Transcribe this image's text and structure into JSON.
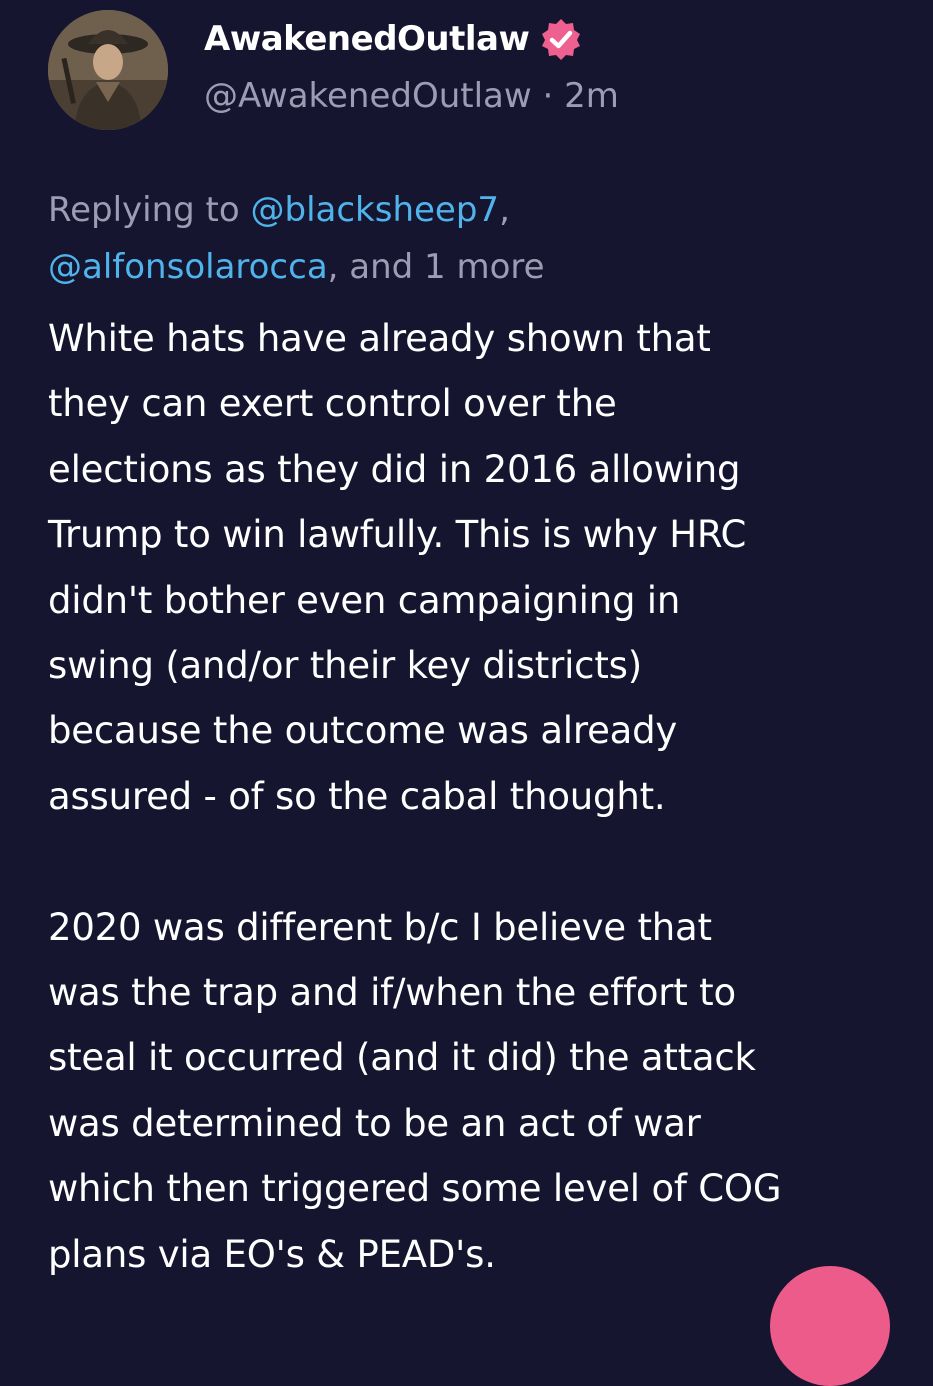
{
  "author": {
    "display_name": "AwakenedOutlaw",
    "handle": "@AwakenedOutlaw",
    "separator": "·",
    "time": "2m",
    "verified_badge_icon": "verified-badge-icon",
    "badge_color": "#ee6090"
  },
  "reply_context": {
    "prefix": "Replying to ",
    "mention_1": "@blacksheep7",
    "comma": ",",
    "mention_2": "@alfonsolarocca",
    "suffix": ", and 1 more"
  },
  "body": {
    "paragraph_1": [
      "White hats have already shown that",
      "they can exert control over the",
      "elections as they did in 2016 allowing",
      "Trump to win lawfully.  This is why HRC",
      "didn't bother even campaigning in",
      "swing (and/or their key districts)",
      "because the outcome was already",
      "assured - of so the cabal thought."
    ],
    "paragraph_2": [
      "2020 was different b/c I believe that",
      "was the trap and if/when the effort to",
      "steal it occurred (and it did) the attack",
      "was determined to be an act of war",
      "which then triggered some level of COG",
      "plans via EO's & PEAD's."
    ]
  },
  "colors": {
    "background": "#151530",
    "text": "#ffffff",
    "muted": "#9e9cb4",
    "mention": "#4fb4ec",
    "fab": "#ec5b8a"
  }
}
